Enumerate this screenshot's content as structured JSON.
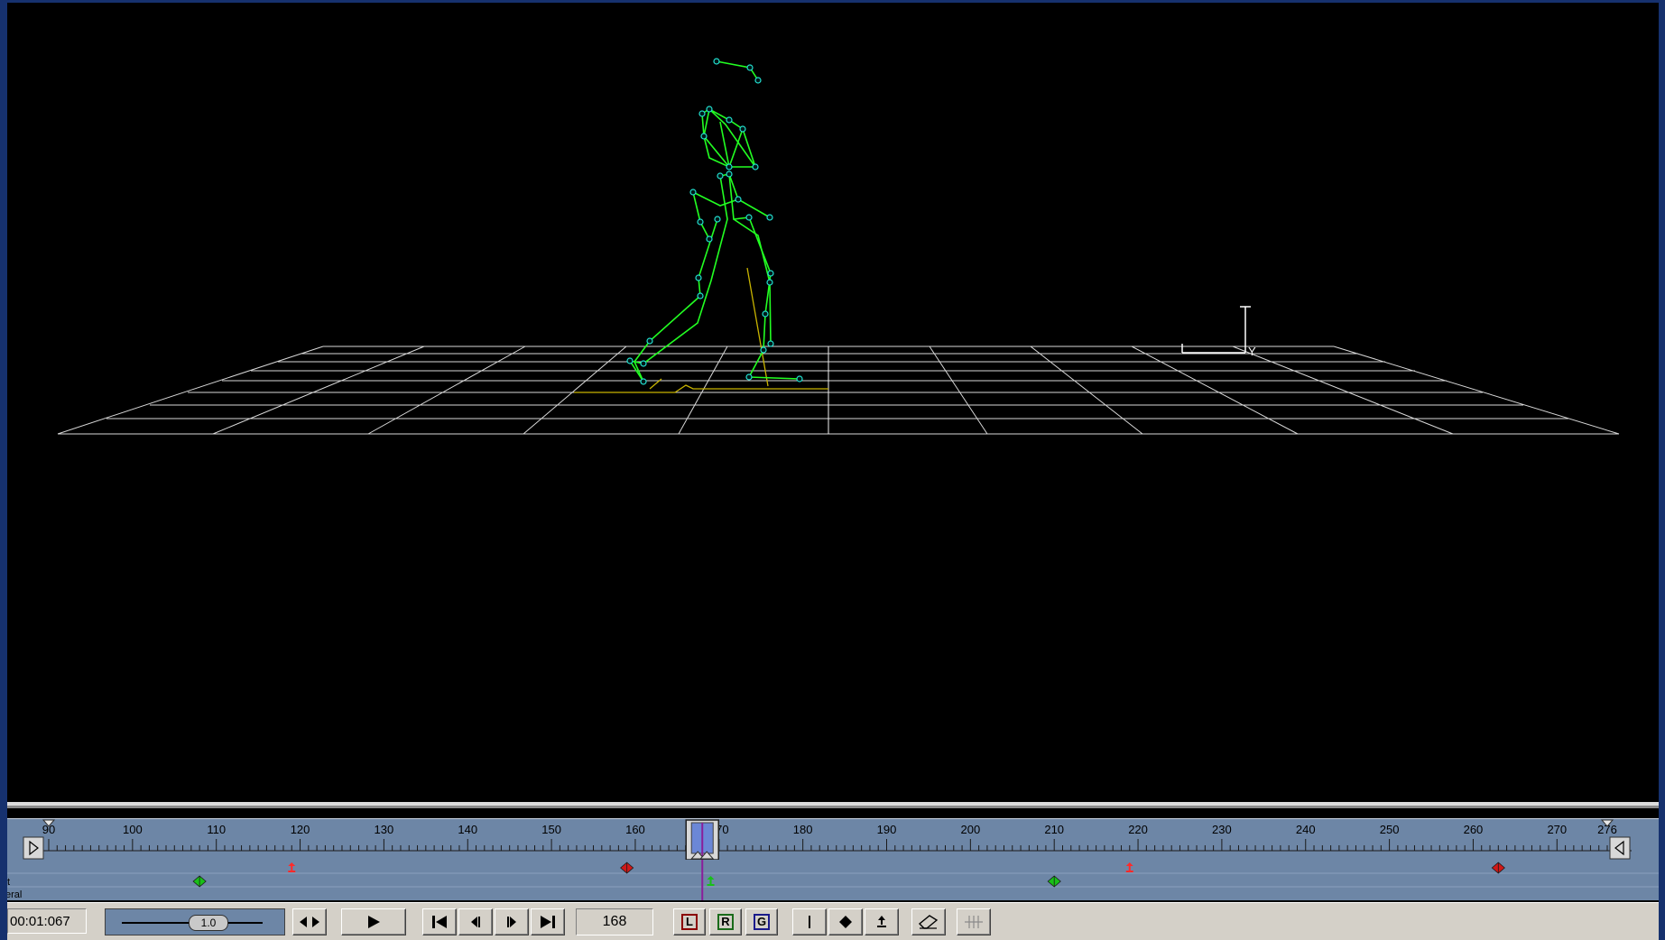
{
  "viewport": {
    "axis_label": "Y"
  },
  "timeline": {
    "ticks": [
      "90",
      "100",
      "110",
      "120",
      "130",
      "140",
      "150",
      "160",
      "170",
      "180",
      "190",
      "200",
      "210",
      "220",
      "230",
      "240",
      "250",
      "260",
      "270",
      "276"
    ],
    "current_frame": 168,
    "range_start": 90,
    "range_end": 276,
    "track_labels": [
      "t",
      "eral"
    ],
    "keys_row1": [
      {
        "frame": 119,
        "type": "up-down",
        "color": "#ff2a2a"
      },
      {
        "frame": 159,
        "type": "diamond",
        "color": "#d01818"
      },
      {
        "frame": 219,
        "type": "up-down",
        "color": "#ff2a2a"
      },
      {
        "frame": 263,
        "type": "diamond",
        "color": "#d01818"
      }
    ],
    "keys_row2": [
      {
        "frame": 108,
        "type": "diamond",
        "color": "#18c018"
      },
      {
        "frame": 169,
        "type": "up-down",
        "color": "#18c018"
      },
      {
        "frame": 210,
        "type": "diamond",
        "color": "#18c018"
      }
    ]
  },
  "toolbar": {
    "time": "00:01:067",
    "speed": "1.0",
    "frame": "168",
    "layer_buttons": [
      "L",
      "R",
      "G"
    ],
    "colors": {
      "L": "#8b0000",
      "R": "#1a6b1a",
      "G": "#1a1a8b"
    }
  },
  "icons": {
    "ping_pong": "ping-pong-icon",
    "play": "play-icon",
    "first": "go-to-start-icon",
    "prev": "previous-frame-icon",
    "next": "next-frame-icon",
    "last": "go-to-end-icon",
    "bar_key": "bar-key-icon",
    "diamond_key": "diamond-key-icon",
    "updown_key": "up-down-key-icon",
    "eraser": "eraser-icon",
    "grid": "grid-snap-icon"
  }
}
